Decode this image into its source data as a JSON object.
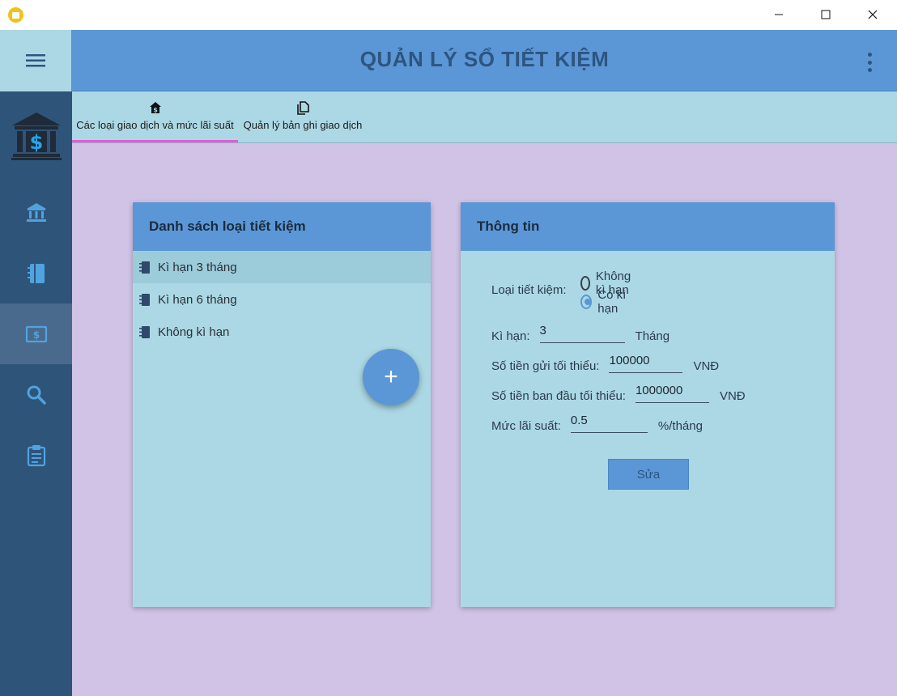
{
  "window": {
    "app_icon": "bank-app-icon",
    "controls": [
      "minimize-icon",
      "maximize-icon",
      "close-icon"
    ]
  },
  "header": {
    "title": "QUẢN LÝ SỔ TIẾT KIỆM",
    "menu_icon": "hamburger-menu-icon",
    "more_icon": "more-vertical-icon"
  },
  "sidebar": {
    "logo_icon": "bank-dollar-logo-icon",
    "items": [
      {
        "icon": "bank-icon",
        "active": false
      },
      {
        "icon": "notebook-icon",
        "active": false
      },
      {
        "icon": "money-icon",
        "active": true
      },
      {
        "icon": "search-icon",
        "active": false
      },
      {
        "icon": "clipboard-icon",
        "active": false
      }
    ]
  },
  "tabs": [
    {
      "label": "Các loại giao dịch và mức lãi suất",
      "icon": "house-dollar-icon",
      "active": true
    },
    {
      "label": "Quản lý bản ghi giao dịch",
      "icon": "copy-pages-icon",
      "active": false
    }
  ],
  "list_card": {
    "title": "Danh sách loại tiết kiệm",
    "items": [
      {
        "label": "Kì hạn 3 tháng",
        "selected": true
      },
      {
        "label": "Kì hạn 6 tháng",
        "selected": false
      },
      {
        "label": "Không kì hạn",
        "selected": false
      }
    ],
    "fab_label": "+"
  },
  "info_card": {
    "title": "Thông tin",
    "savings_type_label": "Loại tiết kiệm:",
    "options": [
      {
        "label": "Không kì hạn",
        "checked": false
      },
      {
        "label": "Có kì hạn",
        "checked": true
      }
    ],
    "term_label": "Kì hạn:",
    "term_value": "3",
    "term_unit": "Tháng",
    "min_deposit_label": "Số tiền gửi tối thiểu:",
    "min_deposit_value": "100000",
    "min_deposit_unit": "VNĐ",
    "min_initial_label": "Số tiền ban đầu tối thiểu:",
    "min_initial_value": "1000000",
    "min_initial_unit": "VNĐ",
    "rate_label": "Mức lãi suất:",
    "rate_value": "0.5",
    "rate_unit": "%/tháng",
    "edit_button": "Sửa"
  },
  "colors": {
    "primary": "#5b97d6",
    "light": "#acd8e5",
    "sidebar": "#2f5479",
    "background": "#d0c3e6",
    "accent": "#e45bd5"
  }
}
